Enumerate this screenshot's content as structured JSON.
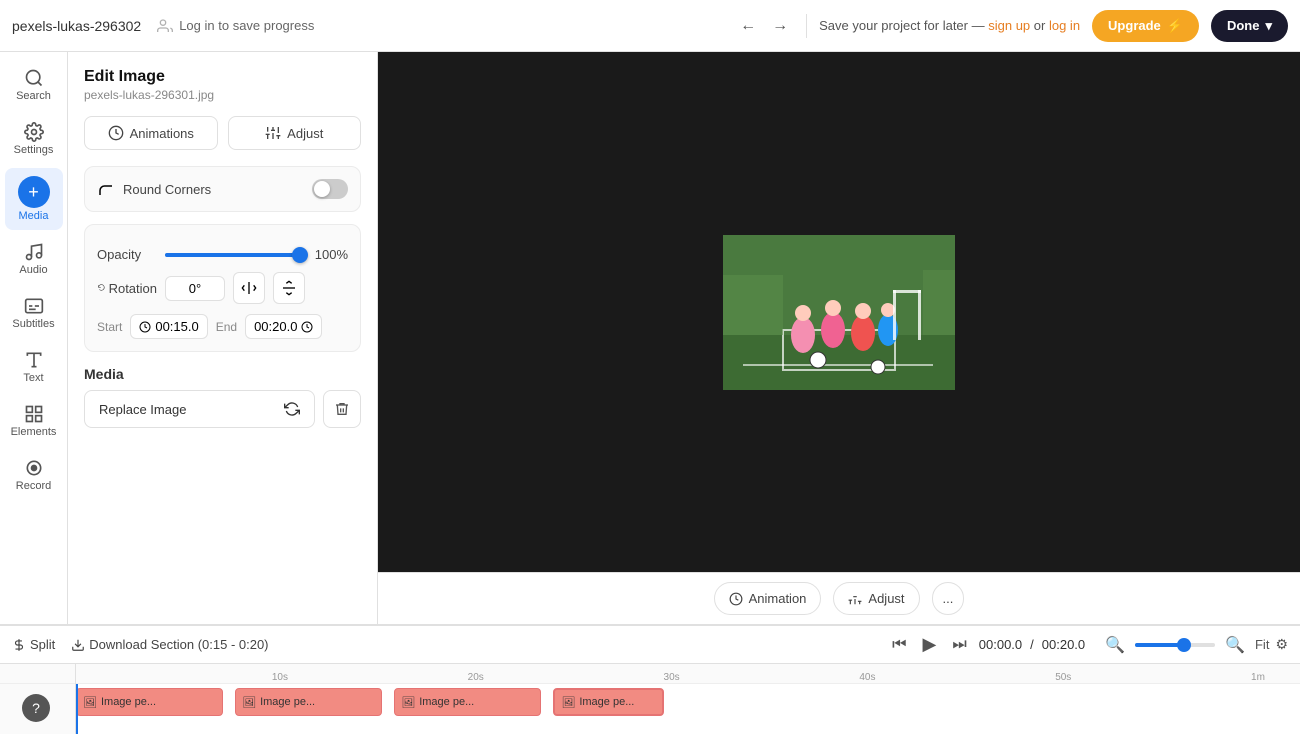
{
  "topbar": {
    "filename": "pexels-lukas-296302",
    "save_label": "Log in to save progress",
    "save_project_text": "Save your project for later —",
    "sign_up": "sign up",
    "or": "or",
    "log_in": "log in",
    "upgrade_label": "Upgrade",
    "done_label": "Done"
  },
  "sidebar": {
    "items": [
      {
        "id": "search",
        "label": "Search",
        "icon": "🔍"
      },
      {
        "id": "settings",
        "label": "Settings",
        "icon": "⚙"
      },
      {
        "id": "media",
        "label": "Media",
        "icon": "+"
      },
      {
        "id": "audio",
        "label": "Audio",
        "icon": "🎵"
      },
      {
        "id": "subtitles",
        "label": "Subtitles",
        "icon": "💬"
      },
      {
        "id": "text",
        "label": "Text",
        "icon": "T"
      },
      {
        "id": "elements",
        "label": "Elements",
        "icon": "◇"
      },
      {
        "id": "record",
        "label": "Record",
        "icon": "⏺"
      }
    ],
    "active": "media"
  },
  "edit_panel": {
    "title": "Edit Image",
    "subtitle": "pexels-lukas-296301.jpg",
    "tab_animations": "Animations",
    "tab_adjust": "Adjust",
    "round_corners_label": "Round Corners",
    "round_corners_enabled": false,
    "opacity_label": "Opacity",
    "opacity_value": "100%",
    "rotation_label": "Rotation",
    "rotation_value": "0°",
    "start_label": "Start",
    "start_value": "00:15.0",
    "end_label": "End",
    "end_value": "00:20.0",
    "media_section_label": "Media",
    "replace_image_label": "Replace Image"
  },
  "canvas": {
    "animation_btn": "Animation",
    "adjust_btn": "Adjust",
    "more_btn": "..."
  },
  "timeline": {
    "split_label": "Split",
    "download_section_label": "Download Section (0:15 - 0:20)",
    "current_time": "00:00.0",
    "total_time": "00:20.0",
    "fit_label": "Fit",
    "ruler_marks": [
      "10s",
      "20s",
      "30s",
      "40s",
      "50s",
      "1m"
    ],
    "tracks": [
      {
        "label": "Image pe...",
        "start_pct": 0,
        "width_pct": 12,
        "color": "#f28b82"
      },
      {
        "label": "Image pe...",
        "start_pct": 13,
        "width_pct": 12,
        "color": "#f28b82"
      },
      {
        "label": "Image pe...",
        "start_pct": 26,
        "width_pct": 12,
        "color": "#f28b82"
      },
      {
        "label": "Image pe...",
        "start_pct": 39,
        "width_pct": 10,
        "color": "#f28b82"
      }
    ]
  },
  "help": {
    "label": "?"
  }
}
